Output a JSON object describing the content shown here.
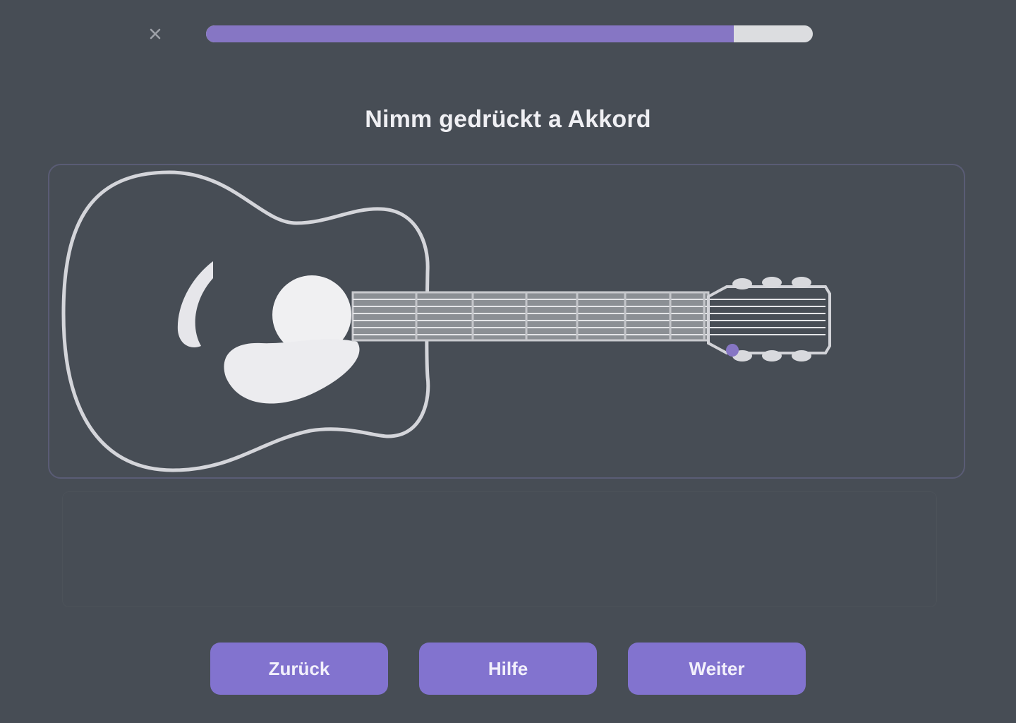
{
  "header": {
    "close_icon": "close-icon",
    "progress_fraction": 0.87
  },
  "prompt": {
    "text": "Nimm gedrückt a Akkord"
  },
  "guitar": {
    "instrument_icon": "acoustic-guitar-icon",
    "highlight_color": "#8676c4"
  },
  "buttons": [
    {
      "label": "Zurück"
    },
    {
      "label": "Hilfe"
    },
    {
      "label": "Weiter"
    }
  ],
  "colors": {
    "background": "#474d55",
    "accent": "#8273cf",
    "progress_track": "#dcdde0"
  }
}
